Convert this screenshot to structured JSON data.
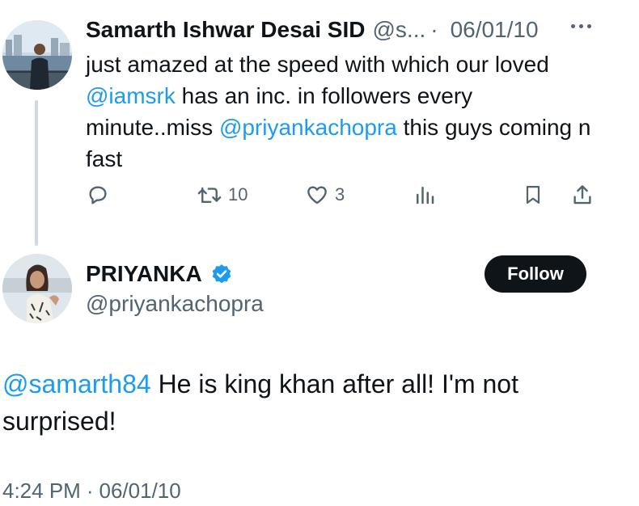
{
  "reply_tweet": {
    "display_name": "Samarth Ishwar Desai SID",
    "handle": "@s...",
    "separator": "·",
    "date": "06/01/10",
    "text_parts": [
      "just amazed at the speed with which our loved ",
      "@iamsrk",
      " has an inc. in followers every minute..miss ",
      "@priyankachopra",
      " this guys coming n fast"
    ],
    "retweet_count": "10",
    "like_count": "3"
  },
  "main_tweet": {
    "display_name": "PRIYANKA",
    "handle": "@priyankachopra",
    "follow_label": "Follow",
    "text_parts": [
      "@samarth84",
      " He is king khan after all! I'm not surprised!"
    ],
    "time": "4:24 PM",
    "separator": "·",
    "date": "06/01/10"
  },
  "colors": {
    "link": "#1d9bf0",
    "muted": "#536471",
    "verified": "#1d9bf0",
    "follow_button": "#0f1419"
  },
  "icons": [
    "reply-icon",
    "retweet-icon",
    "like-icon",
    "views-icon",
    "bookmark-icon",
    "share-icon",
    "more-icon",
    "verified-badge-icon"
  ]
}
